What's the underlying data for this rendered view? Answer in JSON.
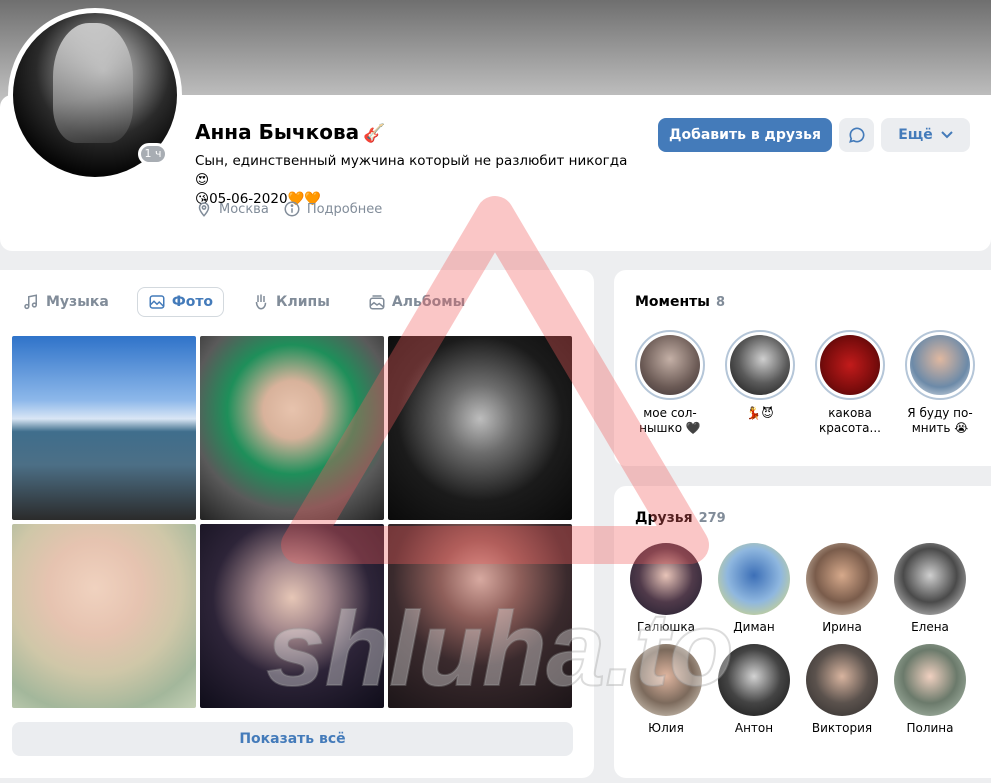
{
  "profile": {
    "name": "Анна Бычкова",
    "name_emoji": "🎸",
    "status_line1": "Сын, единственный мужчина который не разлюбит никогда",
    "status_emoji1": "😍",
    "status_emoji2": "😘",
    "status_date": "05-06-2020",
    "status_hearts": "🧡🧡",
    "online": "1 ч",
    "city": "Москва",
    "details": "Подробнее"
  },
  "actions": {
    "add_friend": "Добавить в друзья",
    "more": "Ещё"
  },
  "tabs": [
    {
      "label": "Музыка",
      "icon": "music-note-icon"
    },
    {
      "label": "Фото",
      "icon": "photo-icon"
    },
    {
      "label": "Клипы",
      "icon": "clips-icon"
    },
    {
      "label": "Альбомы",
      "icon": "albums-icon"
    }
  ],
  "show_all": "Показать всё",
  "moments": {
    "title": "Моменты",
    "count": "8",
    "items": [
      {
        "label": "мое сол-нышко 🖤"
      },
      {
        "label": "💃😈"
      },
      {
        "label": "какова красота..."
      },
      {
        "label": "Я буду по-мнить 😭"
      }
    ]
  },
  "friends": {
    "title": "Друзья",
    "count": "279",
    "items": [
      {
        "name": "Галюшка"
      },
      {
        "name": "Диман"
      },
      {
        "name": "Ирина"
      },
      {
        "name": "Елена"
      },
      {
        "name": "Юлия"
      },
      {
        "name": "Антон"
      },
      {
        "name": "Виктория"
      },
      {
        "name": "Полина"
      }
    ]
  },
  "watermark": {
    "text": "shluha.to"
  },
  "colors": {
    "accent": "#447bba",
    "muted": "#818c99",
    "background": "#edeef0"
  }
}
